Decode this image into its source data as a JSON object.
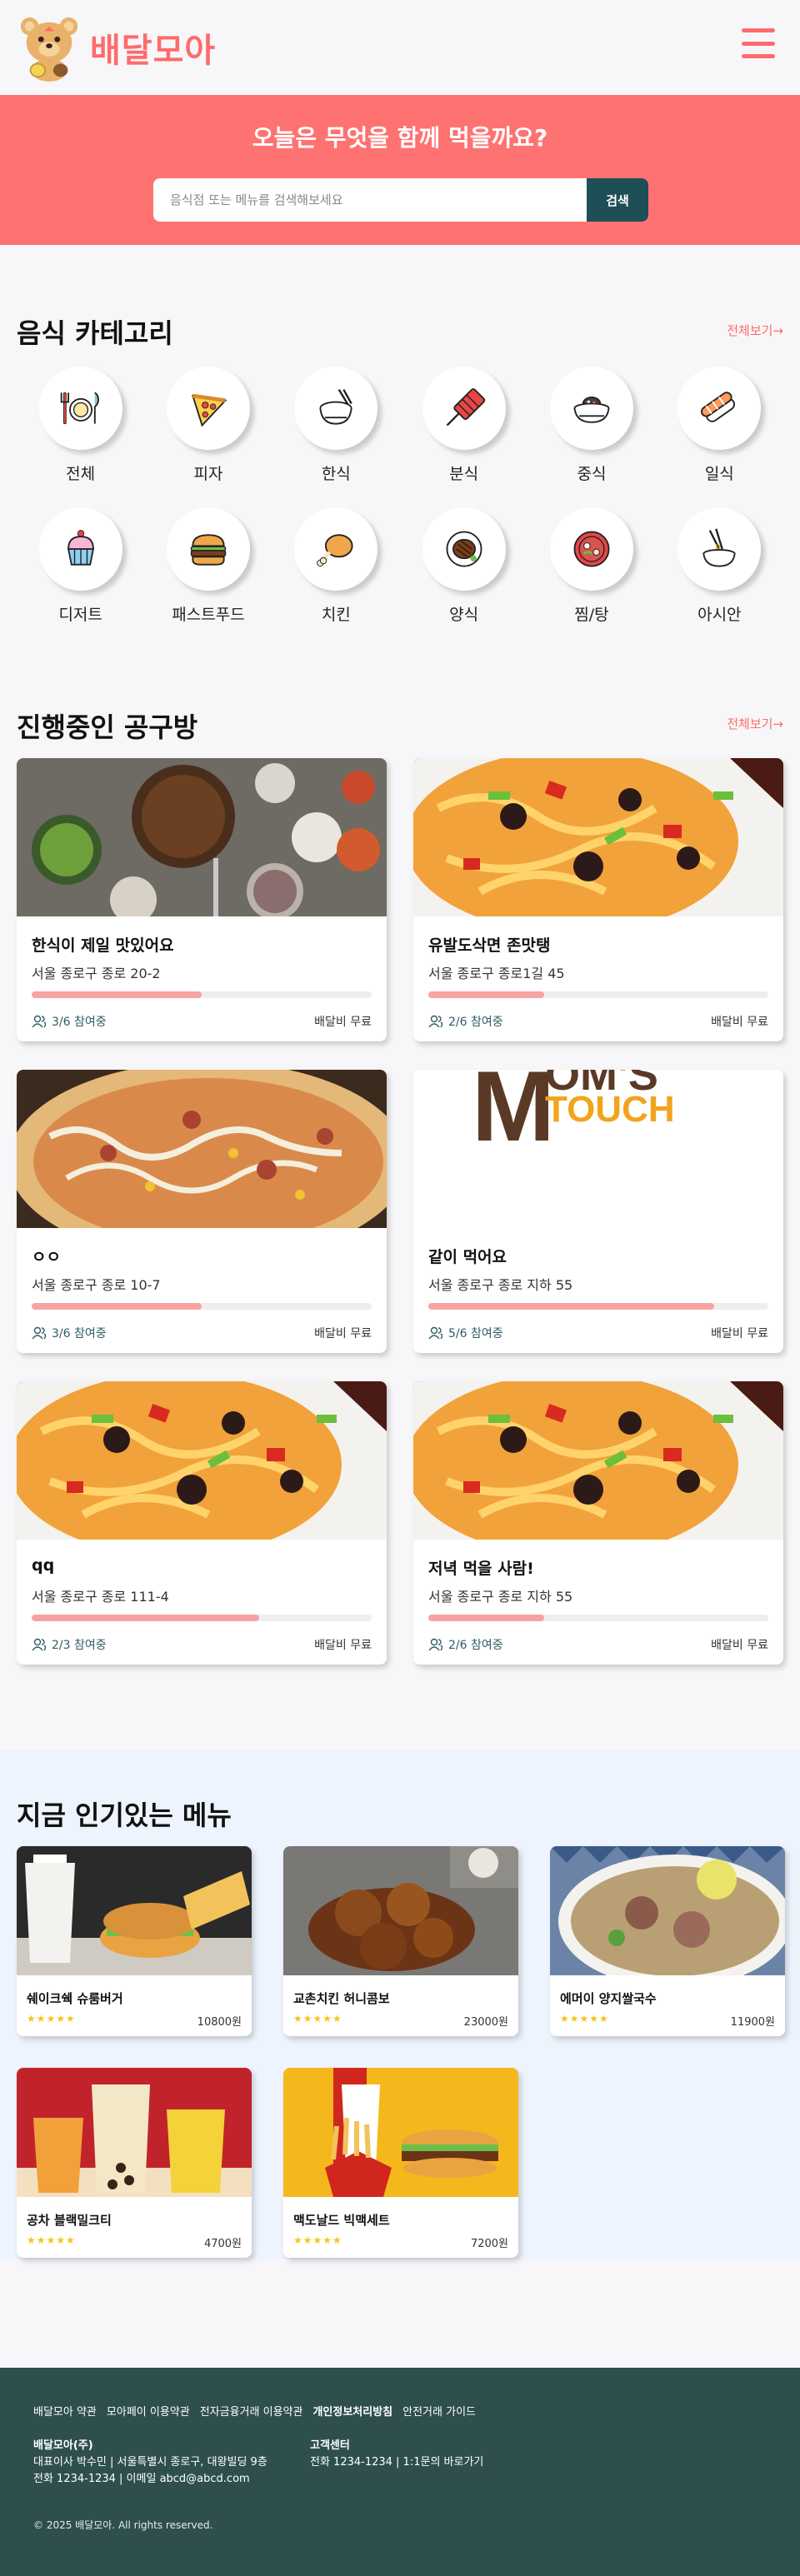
{
  "header": {
    "logo_text": "배달모아",
    "menu_icon": "hamburger-menu-icon"
  },
  "hero": {
    "title": "오늘은 무엇을 함께 먹을까요?",
    "search_placeholder": "음식점 또는 메뉴를 검색해보세요",
    "search_button": "검색"
  },
  "categories": {
    "title": "음식 카테고리",
    "view_all": "전체보기→",
    "items": [
      {
        "label": "전체",
        "icon": "utensils-icon"
      },
      {
        "label": "피자",
        "icon": "pizza-icon"
      },
      {
        "label": "한식",
        "icon": "rice-bowl-icon"
      },
      {
        "label": "분식",
        "icon": "skewer-icon"
      },
      {
        "label": "중식",
        "icon": "noodle-bowl-icon"
      },
      {
        "label": "일식",
        "icon": "sushi-icon"
      },
      {
        "label": "디저트",
        "icon": "cupcake-icon"
      },
      {
        "label": "패스트푸드",
        "icon": "burger-icon"
      },
      {
        "label": "치킨",
        "icon": "chicken-icon"
      },
      {
        "label": "양식",
        "icon": "steak-icon"
      },
      {
        "label": "찜/탕",
        "icon": "hot-pot-icon"
      },
      {
        "label": "아시안",
        "icon": "chopsticks-noodle-icon"
      }
    ]
  },
  "group_buys": {
    "title": "진행중인 공구방",
    "view_all": "전체보기→",
    "items": [
      {
        "title": "한식이 제일 맛있어요",
        "address": "서울 종로구 종로 20-2",
        "progress": 0.5,
        "participants": "3/6 참여중",
        "fee": "배달비 무료",
        "image": "korean-table"
      },
      {
        "title": "유발도삭면 존맛탱",
        "address": "서울 종로구 종로1길 45",
        "progress": 0.34,
        "participants": "2/6 참여중",
        "fee": "배달비 무료",
        "image": "noodle-plate"
      },
      {
        "title": "ㅇㅇ",
        "address": "서울 종로구 종로 10-7",
        "progress": 0.5,
        "participants": "3/6 참여중",
        "fee": "배달비 무료",
        "image": "pizza"
      },
      {
        "title": "같이 먹어요",
        "address": "서울 종로구 종로 지하 55",
        "progress": 0.84,
        "participants": "5/6 참여중",
        "fee": "배달비 무료",
        "image": "moms-touch",
        "image_text": [
          "M",
          "OM'S",
          "TOUCH"
        ]
      },
      {
        "title": "qq",
        "address": "서울 종로구 종로 111-4",
        "progress": 0.67,
        "participants": "2/3 참여중",
        "fee": "배달비 무료",
        "image": "noodle-plate"
      },
      {
        "title": "저녁 먹을 사람!",
        "address": "서울 종로구 종로 지하 55",
        "progress": 0.34,
        "participants": "2/6 참여중",
        "fee": "배달비 무료",
        "image": "noodle-plate"
      }
    ]
  },
  "popular": {
    "title": "지금 인기있는 메뉴",
    "items": [
      {
        "name": "쉐이크쉑 슈룸버거",
        "stars": "★★★★★",
        "rating": 5,
        "price": "10800원",
        "image": "burger-shake"
      },
      {
        "name": "교촌치킨 허니콤보",
        "stars": "★★★★★",
        "rating": 5,
        "price": "23000원",
        "image": "fried-chicken"
      },
      {
        "name": "에머이 양지쌀국수",
        "stars": "★★★★★",
        "rating": 5,
        "price": "11900원",
        "image": "pho"
      },
      {
        "name": "공차 블랙밀크티",
        "stars": "★★★★★",
        "rating": 5,
        "price": "4700원",
        "image": "bubble-tea"
      },
      {
        "name": "맥도날드 빅맥세트",
        "stars": "★★★★★",
        "rating": 5,
        "price": "7200원",
        "image": "bigmac-set"
      }
    ]
  },
  "footer": {
    "links": [
      "배달모아 약관",
      "모아페이 이용약관",
      "전자금융거래 이용약관",
      "개인정보처리방침",
      "안전거래 가이드"
    ],
    "company_title": "배달모아(주)",
    "company_line1": "대표이사 박수민 | 서울특별시 종로구, 대왕빌딩 9층",
    "company_line2": "전화 1234-1234 | 이메일 abcd@abcd.com",
    "support_title": "고객센터",
    "support_line": "전화 1234-1234 | 1:1문의 바로가기",
    "copyright": "© 2025 배달모아. All rights reserved."
  },
  "colors": {
    "accent": "#ff6b6b",
    "hero_bg": "#ff7272",
    "footer_bg": "#2f4f4f",
    "button_bg": "#1f4f56",
    "progress": "#f7a3a3",
    "star": "#f5c518"
  }
}
